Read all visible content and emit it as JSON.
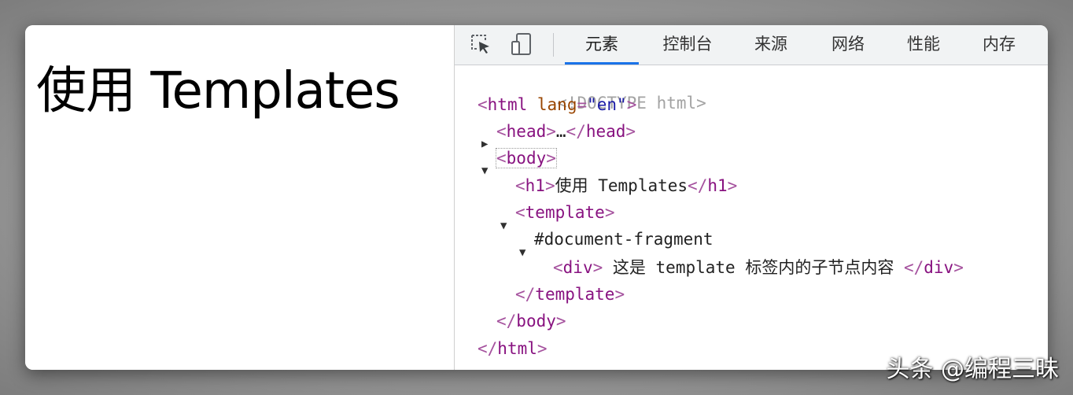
{
  "page": {
    "heading": "使用 Templates"
  },
  "devtools": {
    "tools": [
      {
        "icon": "inspect-element-icon"
      },
      {
        "icon": "device-toolbar-icon"
      }
    ],
    "tabs": [
      {
        "label": "元素",
        "active": true
      },
      {
        "label": "控制台",
        "active": false
      },
      {
        "label": "来源",
        "active": false
      },
      {
        "label": "网络",
        "active": false
      },
      {
        "label": "性能",
        "active": false
      },
      {
        "label": "内存",
        "active": false
      }
    ],
    "tree": {
      "doctype": "<!DOCTYPE html>",
      "html_open": "html",
      "lang_attr": "lang",
      "lang_value": "\"en\"",
      "head_tag": "head",
      "head_ellipsis": "…",
      "body_tag": "body",
      "h1_tag": "h1",
      "h1_text": "使用 Templates",
      "template_tag": "template",
      "fragment": "#document-fragment",
      "div_tag": "div",
      "div_text": " 这是 template 标签内的子节点内容 "
    }
  },
  "watermark": "头条 @编程三昧",
  "colors": {
    "tag": "#881280",
    "attr_name": "#994500",
    "attr_value": "#1a1aa6",
    "active_tab_underline": "#1a73e8",
    "doctype": "#a3a3a3"
  }
}
